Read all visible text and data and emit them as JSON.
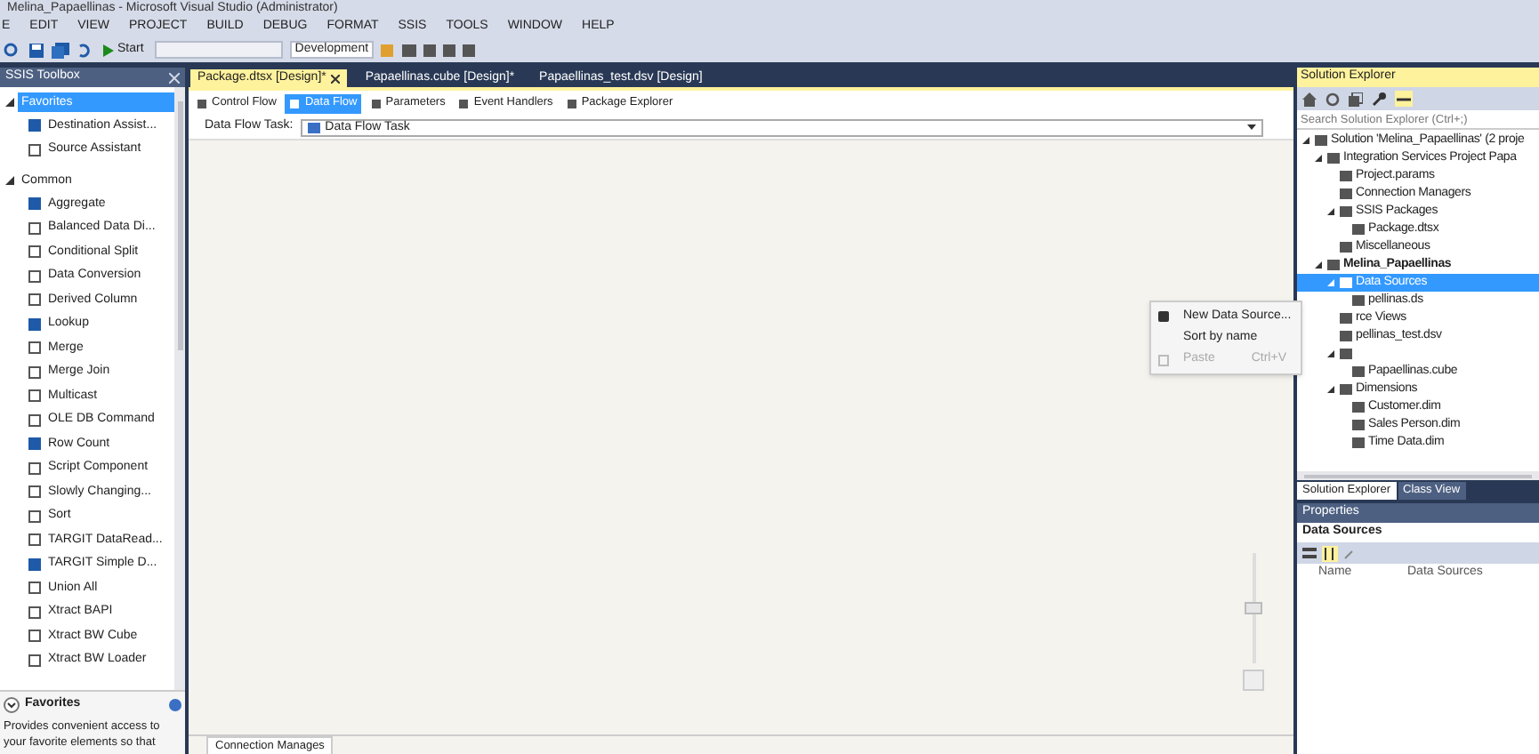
{
  "window": {
    "title": "Melina_Papaellinas - Microsoft Visual Studio (Administrator)"
  },
  "menu": [
    "E",
    "EDIT",
    "VIEW",
    "PROJECT",
    "BUILD",
    "DEBUG",
    "FORMAT",
    "SSIS",
    "TOOLS",
    "WINDOW",
    "HELP"
  ],
  "toolbar": {
    "start": "Start",
    "configuration": "Development"
  },
  "toolbox": {
    "title": "SSIS Toolbox",
    "groups": [
      {
        "label": "Favorites",
        "selected": true,
        "expanded": true,
        "items": [
          "Destination Assist...",
          "Source Assistant"
        ]
      },
      {
        "label": "Common",
        "selected": false,
        "expanded": true,
        "items": [
          "Aggregate",
          "Balanced Data Di...",
          "Conditional Split",
          "Data Conversion",
          "Derived Column",
          "Lookup",
          "Merge",
          "Merge Join",
          "Multicast",
          "OLE DB Command",
          "Row Count",
          "Script Component",
          "Slowly Changing...",
          "Sort",
          "TARGIT DataRead...",
          "TARGIT Simple D...",
          "Union All",
          "Xtract BAPI",
          "Xtract BW Cube",
          "Xtract BW Loader"
        ]
      }
    ],
    "info": {
      "title": "Favorites",
      "text": "Provides convenient access to your favorite elements so that"
    }
  },
  "documents": [
    {
      "label": "Package.dtsx [Design]*",
      "selected": true
    },
    {
      "label": "Papaellinas.cube [Design]*",
      "selected": false
    },
    {
      "label": "Papaellinas_test.dsv [Design]",
      "selected": false
    }
  ],
  "designer_tabs": [
    {
      "label": "Control Flow",
      "selected": false
    },
    {
      "label": "Data Flow",
      "selected": true
    },
    {
      "label": "Parameters",
      "selected": false
    },
    {
      "label": "Event Handlers",
      "selected": false
    },
    {
      "label": "Package Explorer",
      "selected": false
    }
  ],
  "data_flow_task": {
    "label": "Data Flow Task:",
    "value": "Data Flow Task"
  },
  "bottom_tab": "Connection Manages",
  "zoom": {
    "level": 0.5
  },
  "context_menu": [
    {
      "label": "New Data Source...",
      "disabled": false
    },
    {
      "label": "Sort by name",
      "disabled": false
    },
    {
      "label": "Paste",
      "shortcut": "Ctrl+V",
      "disabled": true
    }
  ],
  "solution_explorer": {
    "title": "Solution Explorer",
    "search": {
      "placeholder": "Search Solution Explorer (Ctrl+;)"
    },
    "tree": [
      {
        "label": "Solution 'Melina_Papaellinas' (2 proje",
        "expanded": true,
        "bold": false,
        "selected": false,
        "children": [
          {
            "label": "Integration Services Project Papa",
            "expanded": true,
            "bold": false,
            "selected": false,
            "children": [
              {
                "label": "Project.params",
                "bold": false,
                "selected": false
              },
              {
                "label": "Connection Managers",
                "bold": false,
                "selected": false
              },
              {
                "label": "SSIS Packages",
                "expanded": true,
                "bold": false,
                "selected": false,
                "children": [
                  {
                    "label": "Package.dtsx",
                    "bold": false,
                    "selected": false
                  }
                ]
              },
              {
                "label": "Miscellaneous",
                "bold": false,
                "selected": false
              }
            ]
          },
          {
            "label": "Melina_Papaellinas",
            "expanded": true,
            "bold": true,
            "selected": false,
            "children": [
              {
                "label": "Data Sources",
                "expanded": true,
                "bold": false,
                "selected": true,
                "children": [
                  {
                    "label": "pellinas.ds",
                    "bold": false,
                    "selected": false
                  }
                ]
              },
              {
                "label": "rce Views",
                "bold": false,
                "selected": false
              },
              {
                "label": "pellinas_test.dsv",
                "bold": false,
                "selected": false
              },
              {
                "expanded": true,
                "selected": false,
                "children": [
                  {
                    "label": "Papaellinas.cube",
                    "bold": false,
                    "selected": false
                  }
                ]
              },
              {
                "label": "Dimensions",
                "expanded": true,
                "bold": false,
                "selected": false,
                "children": [
                  {
                    "label": "Customer.dim",
                    "bold": false,
                    "selected": false
                  },
                  {
                    "label": "Sales Person.dim",
                    "bold": false,
                    "selected": false
                  },
                  {
                    "label": "Time Data.dim",
                    "bold": false,
                    "selected": false
                  }
                ]
              }
            ]
          }
        ]
      }
    ],
    "tabs": [
      {
        "label": "Solution Explorer",
        "selected": true
      },
      {
        "label": "Class View",
        "selected": false
      }
    ]
  },
  "properties": {
    "title": "Properties",
    "object": "Data Sources",
    "columns": [
      "Name",
      "Data Sources"
    ]
  }
}
